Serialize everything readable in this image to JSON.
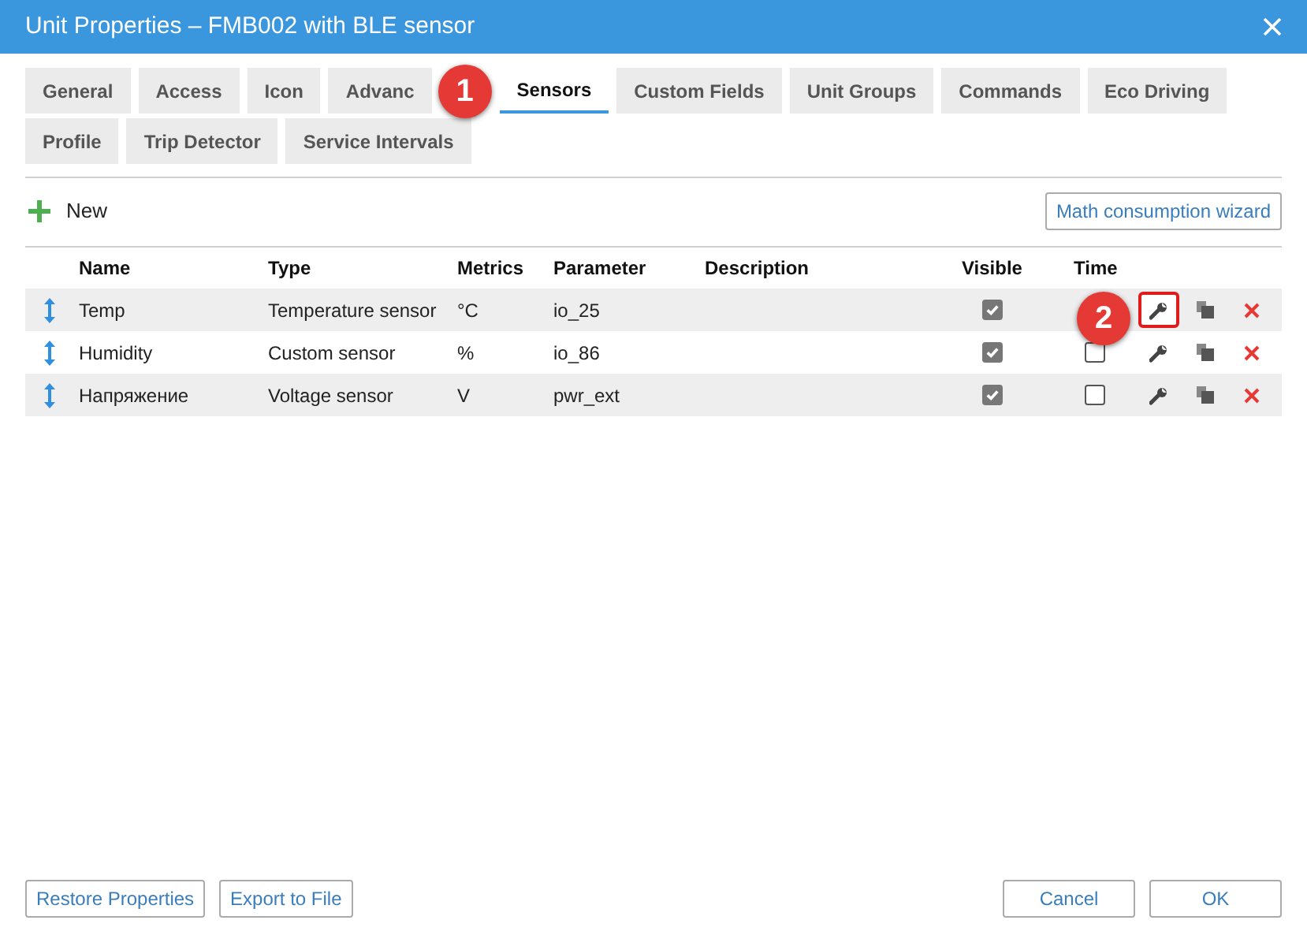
{
  "window": {
    "title": "Unit Properties – FMB002 with BLE sensor"
  },
  "tabs": [
    {
      "label": "General",
      "selected": false
    },
    {
      "label": "Access",
      "selected": false
    },
    {
      "label": "Icon",
      "selected": false
    },
    {
      "label": "Advanc",
      "selected": false
    },
    {
      "label": "Sensors",
      "selected": true
    },
    {
      "label": "Custom Fields",
      "selected": false
    },
    {
      "label": "Unit Groups",
      "selected": false
    },
    {
      "label": "Commands",
      "selected": false
    },
    {
      "label": "Eco Driving",
      "selected": false
    },
    {
      "label": "Profile",
      "selected": false
    },
    {
      "label": "Trip Detector",
      "selected": false
    },
    {
      "label": "Service Intervals",
      "selected": false
    }
  ],
  "toolbar": {
    "new_button": "New",
    "wizard_button": "Math consumption wizard"
  },
  "table": {
    "columns": [
      "Name",
      "Type",
      "Metrics",
      "Parameter",
      "Description",
      "Visible",
      "Time"
    ],
    "rows": [
      {
        "name": "Temp",
        "type": "Temperature sensor",
        "metrics": "°C",
        "parameter": "io_25",
        "visible": true,
        "edit_highlighted": true
      },
      {
        "name": "Humidity",
        "type": "Custom sensor",
        "metrics": "%",
        "parameter": "io_86",
        "visible": true,
        "time": false,
        "edit_highlighted": false
      },
      {
        "name": "Напряжение",
        "type": "Voltage sensor",
        "metrics": "V",
        "parameter": "pwr_ext",
        "visible": true,
        "time": false,
        "edit_highlighted": false
      }
    ]
  },
  "callouts": [
    "1",
    "2"
  ],
  "footer": {
    "left_buttons": [
      "Restore Properties",
      "Export to File"
    ],
    "right_buttons": [
      "Cancel",
      "OK"
    ]
  }
}
